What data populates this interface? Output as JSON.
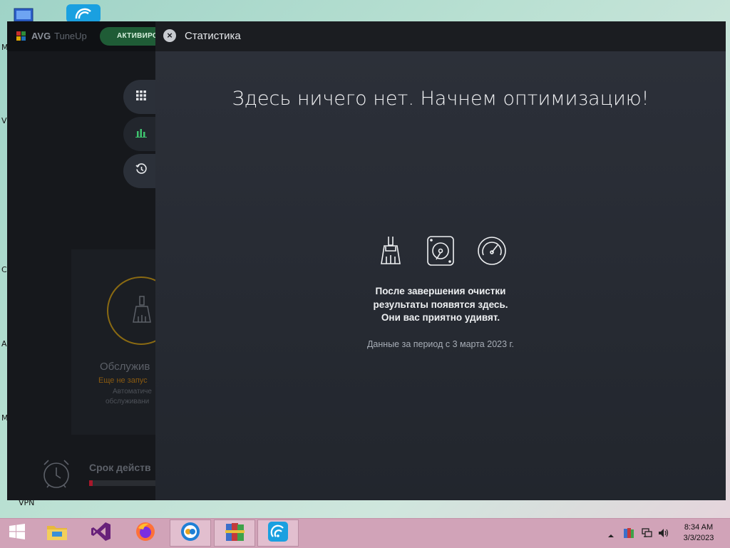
{
  "desktop": {
    "labels": [
      "M",
      "V",
      "C",
      "A",
      "M",
      "VPN"
    ]
  },
  "avg": {
    "brand": "AVG",
    "product": "TuneUp",
    "activate_label": "АКТИВИРО",
    "maintenance": {
      "title": "Обслужив",
      "status": "Еще не запус",
      "desc_line1": "Автоматиче",
      "desc_line2": "обслуживани"
    },
    "subscription": {
      "title": "Срок действ",
      "progress": 0.05
    }
  },
  "stats": {
    "title": "Статистика",
    "headline": "Здесь ничего нет. Начнем оптимизацию!",
    "message": [
      "После завершения очистки",
      "результаты появятся здесь.",
      "Они вас приятно удивят."
    ],
    "period": "Данные за период с 3 марта 2023 г.",
    "icons": [
      "broom-icon",
      "hard-drive-icon",
      "speedometer-icon"
    ]
  },
  "taskbar": {
    "apps": [
      "start-button",
      "file-explorer",
      "visual-studio",
      "firefox",
      "avg-secure-browser",
      "winrar",
      "avg-tuneup"
    ],
    "time": "8:34 AM",
    "date": "3/3/2023"
  }
}
